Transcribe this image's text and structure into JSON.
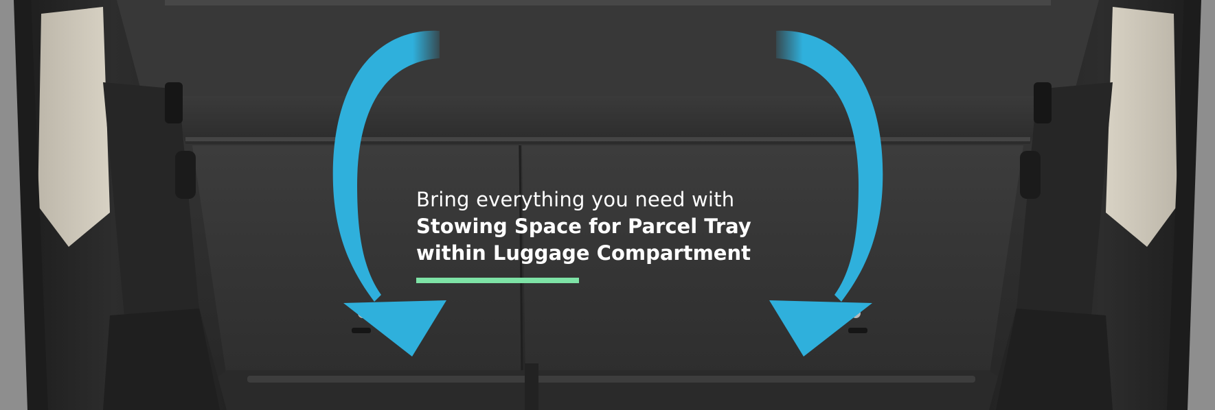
{
  "photo": {
    "subject": "luggage-compartment",
    "icons": [
      "curved-arrow-left-icon",
      "curved-arrow-right-icon"
    ],
    "colors": {
      "arrow": "#2fb0dc",
      "accent": "#7ee3a6",
      "text": "#ffffff"
    }
  },
  "caption": {
    "lead": "Bring everything you need with",
    "headline_line1": "Stowing Space for Parcel Tray",
    "headline_line2": "within Luggage Compartment"
  }
}
